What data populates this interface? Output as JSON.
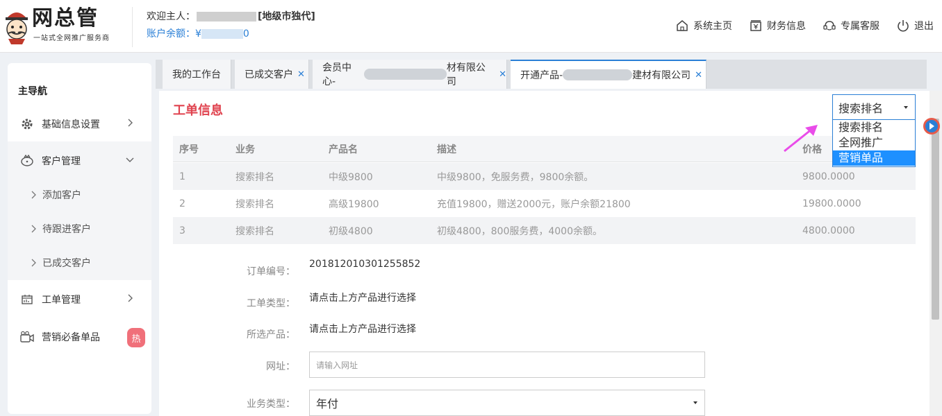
{
  "header": {
    "logo_title": "网总管",
    "logo_sub": "一站式全网推广服务商",
    "welcome_prefix": "欢迎主人：",
    "welcome_role": "[地级市独代]",
    "balance_label": "账户余额：¥",
    "balance_tail": "0",
    "nav": [
      {
        "label": "系统主页",
        "icon": "home-icon"
      },
      {
        "label": "财务信息",
        "icon": "finance-icon"
      },
      {
        "label": "专属客服",
        "icon": "support-icon"
      },
      {
        "label": "退出",
        "icon": "power-icon"
      }
    ]
  },
  "sidebar": {
    "title": "主导航",
    "items": [
      {
        "label": "基础信息设置",
        "icon": "gear-icon"
      },
      {
        "label": "客户管理",
        "icon": "customer-icon"
      },
      {
        "label": "工单管理",
        "icon": "calendar-icon"
      },
      {
        "label": "营销必备单品",
        "icon": "camera-icon",
        "badge": "热"
      }
    ],
    "sub_items": [
      "添加客户",
      "待跟进客户",
      "已成交客户"
    ]
  },
  "tabs": [
    {
      "label": "我的工作台"
    },
    {
      "label": "已成交客户"
    },
    {
      "label_prefix": "会员中心-",
      "label_suffix": "材有限公司"
    },
    {
      "label_prefix": "开通产品-",
      "label_suffix": "建材有限公司"
    }
  ],
  "panel": {
    "title": "工单信息",
    "dropdown": {
      "selected": "搜索排名",
      "options": [
        "搜索排名",
        "全网推广",
        "营销单品"
      ],
      "highlighted": "营销单品"
    },
    "table": {
      "headers": [
        "序号",
        "业务",
        "产品名",
        "描述",
        "价格"
      ],
      "rows": [
        [
          "1",
          "搜索排名",
          "中级9800",
          "中级9800，免服务费，9800余额。",
          "9800.0000"
        ],
        [
          "2",
          "搜索排名",
          "高级19800",
          "充值19800，赠送2000元，账户余额21800",
          "19800.0000"
        ],
        [
          "3",
          "搜索排名",
          "初级4800",
          "初级4800，800服务费，4000余额。",
          "4800.0000"
        ]
      ]
    },
    "form": {
      "order_no_label": "订单编号：",
      "order_no": "201812010301255852",
      "type_label": "工单类型：",
      "type_value": "请点击上方产品进行选择",
      "product_label": "所选产品：",
      "product_value": "请点击上方产品进行选择",
      "url_label": "网址：",
      "url_placeholder": "请输入网址",
      "biz_type_label": "业务类型：",
      "biz_type_value": "年付"
    }
  },
  "colors": {
    "accent": "#2a7fd6",
    "title_red": "#e0434f",
    "badge": "#f0707a",
    "highlight": "#1e90ff",
    "annotation_arrow": "#e94ce9"
  }
}
